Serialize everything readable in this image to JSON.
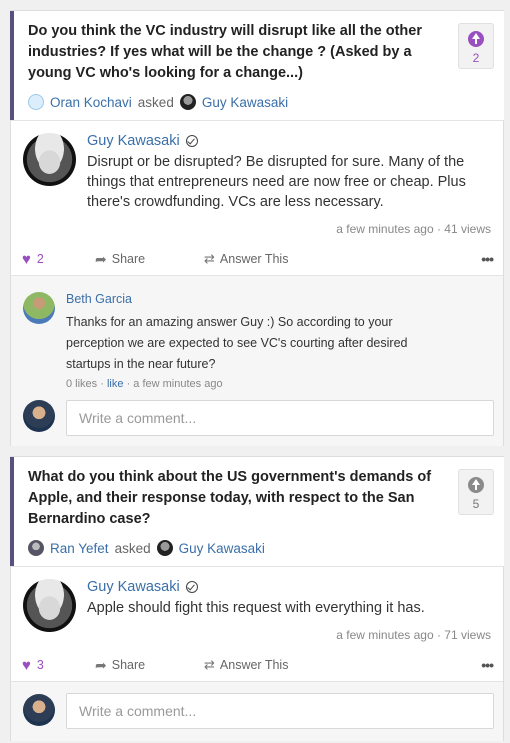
{
  "questions": [
    {
      "title": "Do you think the VC industry will disrupt like all the other industries? If yes what will be the change ? (Asked by a young VC who's looking for a change...)",
      "asker": "Oran Kochavi",
      "asked_word": "asked",
      "askee": "Guy Kawasaki",
      "upvotes": "2",
      "upvote_color": "#9a4fc0",
      "answer": {
        "author": "Guy Kawasaki",
        "text": "Disrupt or be disrupted? Be disrupted for sure. Many of the things that entrepreneurs need are now free or cheap. Plus there's crowdfunding. VCs are less necessary.",
        "meta": "a few minutes ago · 41 views"
      },
      "actions": {
        "likes": "2",
        "share": "Share",
        "answer_this": "Answer This",
        "more": "•••"
      },
      "comment": {
        "author": "Beth Garcia",
        "text": "Thanks for an amazing answer Guy :) So according to your perception we are expected to see VC's courting after desired startups in the near future?",
        "likes": "0 likes",
        "like_link": "like",
        "time": "a few minutes ago"
      },
      "comment_placeholder": "Write a comment..."
    },
    {
      "title": "What do you think about the US government's demands of Apple, and their response today, with respect to the San Bernardino case?",
      "asker": "Ran Yefet",
      "asked_word": "asked",
      "askee": "Guy Kawasaki",
      "upvotes": "5",
      "upvote_color": "#8a8a8a",
      "answer": {
        "author": "Guy Kawasaki",
        "text": "Apple should fight this request with everything it has.",
        "meta": "a few minutes ago · 71 views"
      },
      "actions": {
        "likes": "3",
        "share": "Share",
        "answer_this": "Answer This",
        "more": "•••"
      },
      "comment_placeholder": "Write a comment..."
    }
  ],
  "accent_color": "#9a4fc0",
  "link_color": "#3a6fa8"
}
